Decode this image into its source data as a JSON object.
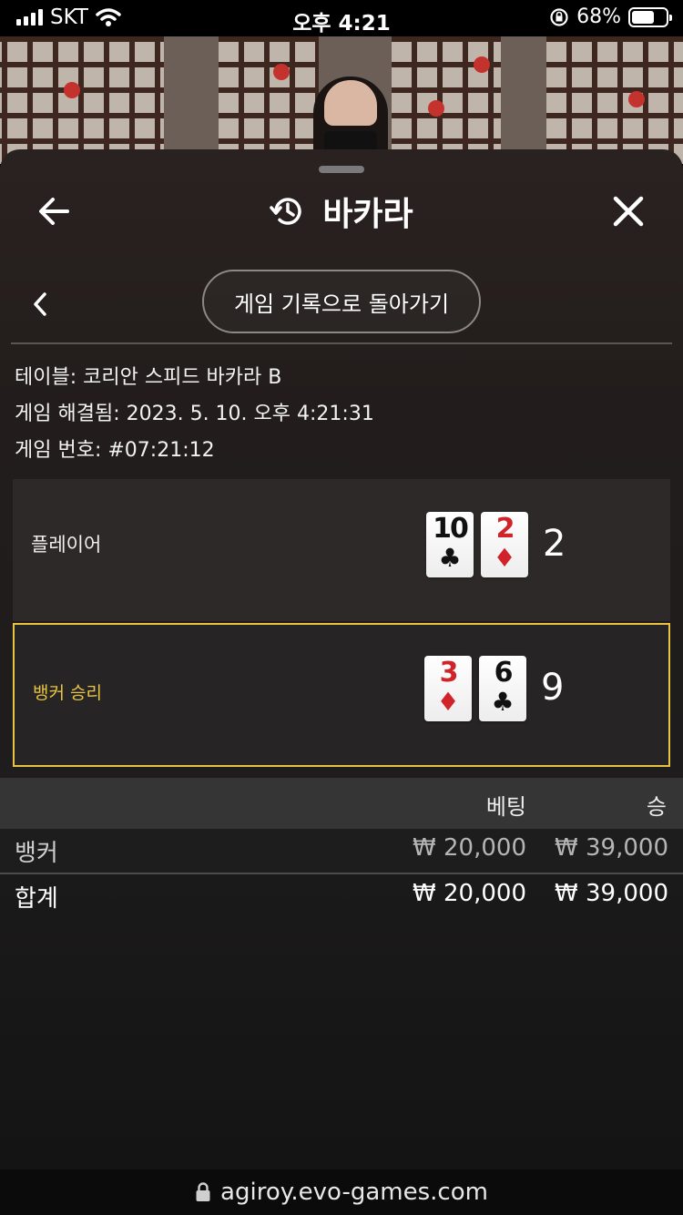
{
  "status_bar": {
    "carrier": "SKT",
    "time": "오후 4:21",
    "battery_percent": "68%",
    "battery_level": 0.68
  },
  "header": {
    "title": "바카라",
    "title_icon": "history-icon",
    "back_icon": "arrow-left-icon",
    "close_icon": "close-icon"
  },
  "nav": {
    "back_icon": "chevron-left-icon",
    "back_to_history_label": "게임 기록으로 돌아가기"
  },
  "game_info": {
    "table": "테이블: 코리안 스피드 바카라 B",
    "resolved": "게임 해결됨: 2023. 5. 10. 오후 4:21:31",
    "number": "게임 번호: #07:21:12"
  },
  "results": {
    "player": {
      "label": "플레이어",
      "cards": [
        {
          "rank": "10",
          "suit": "♣",
          "color": "black"
        },
        {
          "rank": "2",
          "suit": "♦",
          "color": "red"
        }
      ],
      "score": "2"
    },
    "banker": {
      "label": "뱅커 승리",
      "cards": [
        {
          "rank": "3",
          "suit": "♦",
          "color": "red"
        },
        {
          "rank": "6",
          "suit": "♣",
          "color": "black"
        }
      ],
      "score": "9"
    }
  },
  "bets": {
    "headers": {
      "bet": "베팅",
      "win": "승"
    },
    "rows": [
      {
        "label": "뱅커",
        "bet": "₩ 20,000",
        "win": "₩ 39,000"
      }
    ],
    "total": {
      "label": "합계",
      "bet": "₩ 20,000",
      "win": "₩ 39,000"
    }
  },
  "url_bar": {
    "lock_icon": "lock-icon",
    "url": "agiroy.evo-games.com"
  },
  "colors": {
    "winner_accent": "#e9c442",
    "card_red": "#d0232a"
  }
}
